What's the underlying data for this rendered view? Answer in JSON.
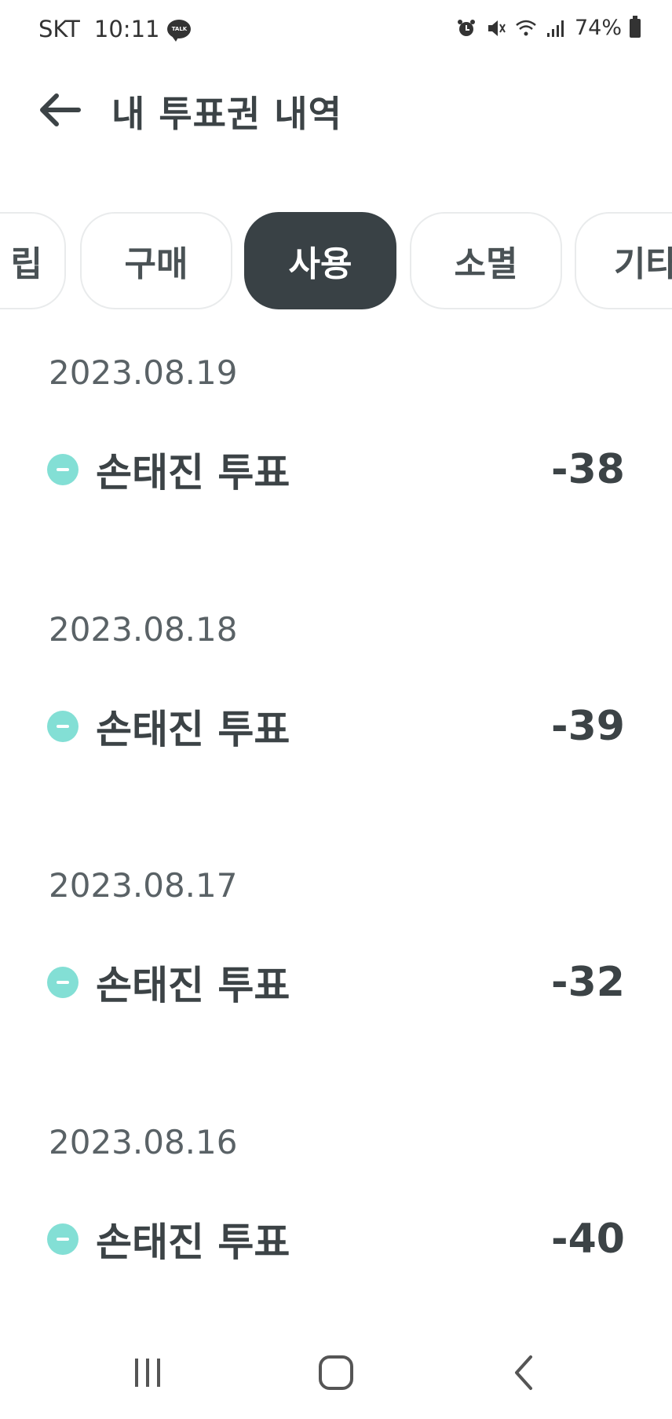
{
  "status_bar": {
    "carrier": "SKT",
    "time": "10:11",
    "talk_badge": "TALK",
    "battery": "74%",
    "icons": [
      "alarm-icon",
      "mute-icon",
      "wifi-icon",
      "signal-icon",
      "battery-icon"
    ]
  },
  "header": {
    "title": "내 투표권 내역",
    "back_icon": "back-arrow-icon"
  },
  "tabs": [
    {
      "label": "적립",
      "visible_text": "립",
      "active": false
    },
    {
      "label": "구매",
      "active": false
    },
    {
      "label": "사용",
      "active": true
    },
    {
      "label": "소멸",
      "active": false
    },
    {
      "label": "기타",
      "visible_text": "기타",
      "active": false
    }
  ],
  "history": [
    {
      "date": "2023.08.19",
      "label": "손태진 투표",
      "amount": "-38"
    },
    {
      "date": "2023.08.18",
      "label": "손태진 투표",
      "amount": "-39"
    },
    {
      "date": "2023.08.17",
      "label": "손태진 투표",
      "amount": "-32"
    },
    {
      "date": "2023.08.16",
      "label": "손태진 투표",
      "amount": "-40"
    }
  ],
  "nav_bar": {
    "icons": [
      "recent-apps-icon",
      "home-icon",
      "back-icon"
    ]
  },
  "colors": {
    "active_tab": "#394145",
    "minus_badge": "#83dfd5",
    "text": "#3c4346"
  }
}
